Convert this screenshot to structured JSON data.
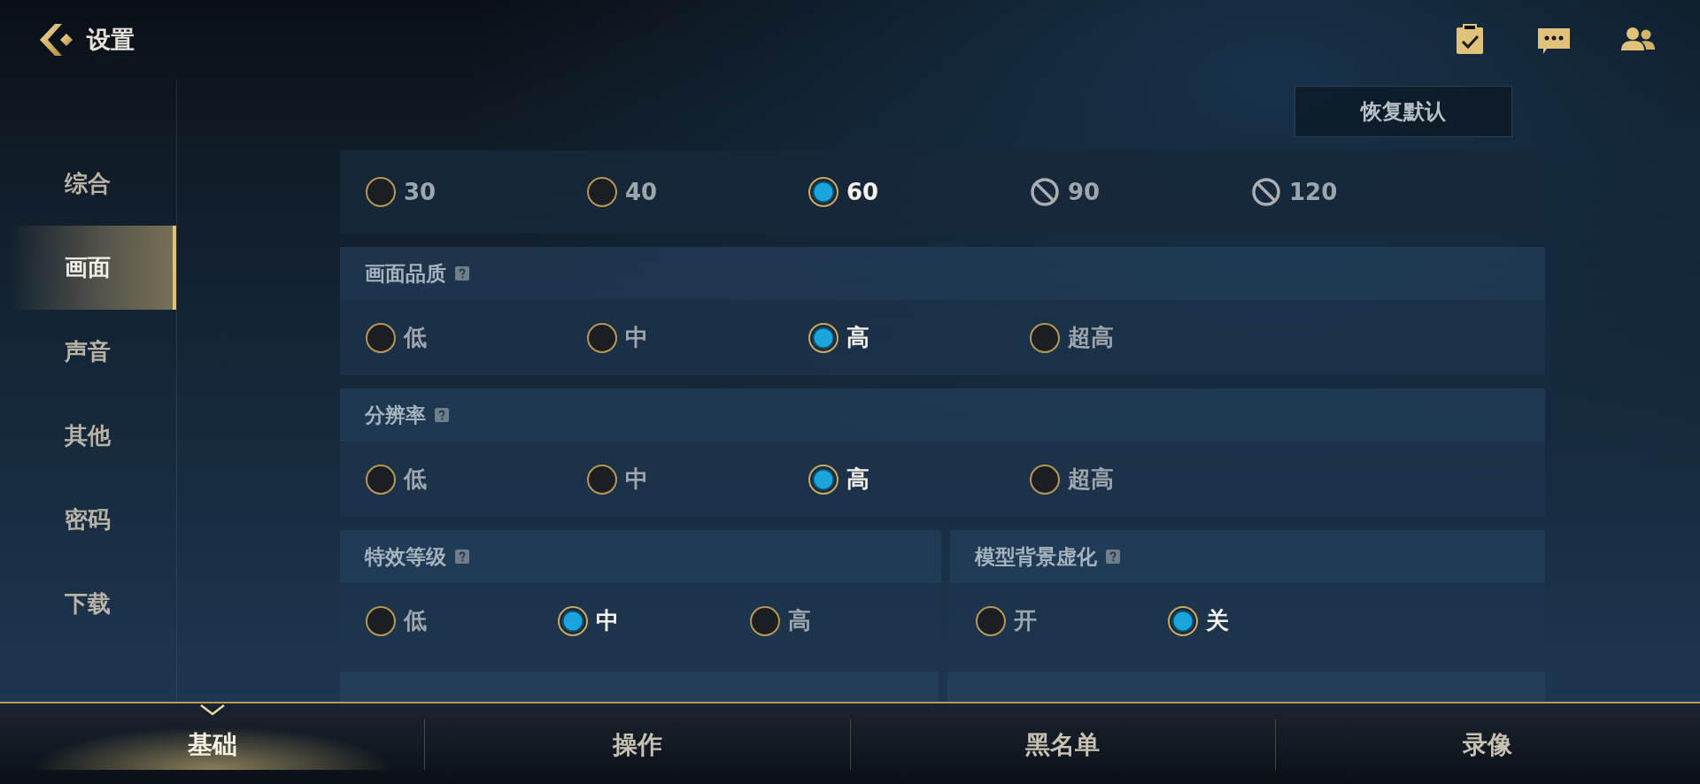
{
  "header": {
    "title": "设置"
  },
  "restore_button": "恢复默认",
  "sidebar": {
    "items": [
      {
        "label": "综合",
        "selected": false
      },
      {
        "label": "画面",
        "selected": true
      },
      {
        "label": "声音",
        "selected": false
      },
      {
        "label": "其他",
        "selected": false
      },
      {
        "label": "密码",
        "selected": false
      },
      {
        "label": "下载",
        "selected": false
      }
    ]
  },
  "sections": [
    {
      "options": [
        {
          "label": "30",
          "selected": false,
          "disabled": false
        },
        {
          "label": "40",
          "selected": false,
          "disabled": false
        },
        {
          "label": "60",
          "selected": true,
          "disabled": false
        },
        {
          "label": "90",
          "selected": false,
          "disabled": true
        },
        {
          "label": "120",
          "selected": false,
          "disabled": true
        }
      ]
    },
    {
      "title": "画面品质",
      "options": [
        {
          "label": "低",
          "selected": false,
          "disabled": false
        },
        {
          "label": "中",
          "selected": false,
          "disabled": false
        },
        {
          "label": "高",
          "selected": true,
          "disabled": false
        },
        {
          "label": "超高",
          "selected": false,
          "disabled": false
        }
      ]
    },
    {
      "title": "分辨率",
      "options": [
        {
          "label": "低",
          "selected": false,
          "disabled": false
        },
        {
          "label": "中",
          "selected": false,
          "disabled": false
        },
        {
          "label": "高",
          "selected": true,
          "disabled": false
        },
        {
          "label": "超高",
          "selected": false,
          "disabled": false
        }
      ]
    },
    {
      "columns": [
        {
          "title": "特效等级",
          "options": [
            {
              "label": "低",
              "selected": false,
              "disabled": false
            },
            {
              "label": "中",
              "selected": true,
              "disabled": false
            },
            {
              "label": "高",
              "selected": false,
              "disabled": false
            }
          ]
        },
        {
          "title": "模型背景虚化",
          "options": [
            {
              "label": "开",
              "selected": false,
              "disabled": false
            },
            {
              "label": "关",
              "selected": true,
              "disabled": false
            }
          ]
        }
      ]
    }
  ],
  "bottom_tabs": [
    {
      "label": "基础",
      "selected": true
    },
    {
      "label": "操作",
      "selected": false
    },
    {
      "label": "黑名单",
      "selected": false
    },
    {
      "label": "录像",
      "selected": false
    }
  ]
}
